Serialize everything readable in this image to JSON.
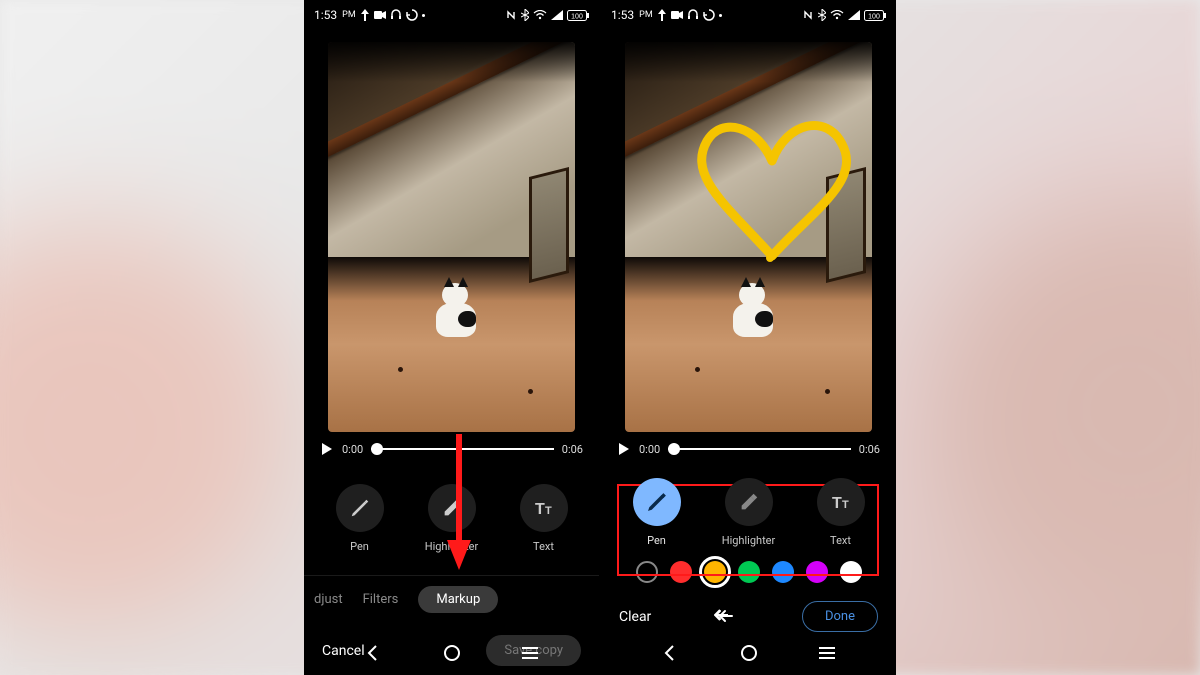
{
  "status": {
    "time": "1:53",
    "ampm": "PM",
    "battery": "100"
  },
  "video": {
    "current_time": "0:00",
    "duration": "0:06"
  },
  "tools": {
    "pen": "Pen",
    "highlighter": "Highlighter",
    "text": "Text"
  },
  "tabs": {
    "adjust": "djust",
    "filters": "Filters",
    "markup": "Markup"
  },
  "actions": {
    "cancel": "Cancel",
    "save_copy": "Save copy",
    "clear": "Clear",
    "done": "Done"
  },
  "colors": {
    "red": "#ff2d2d",
    "yellow": "#ffb400",
    "green": "#00c853",
    "blue": "#1e88ff",
    "magenta": "#d500f9",
    "white": "#ffffff",
    "selected": "yellow",
    "draw_stroke": "#f5c400"
  }
}
